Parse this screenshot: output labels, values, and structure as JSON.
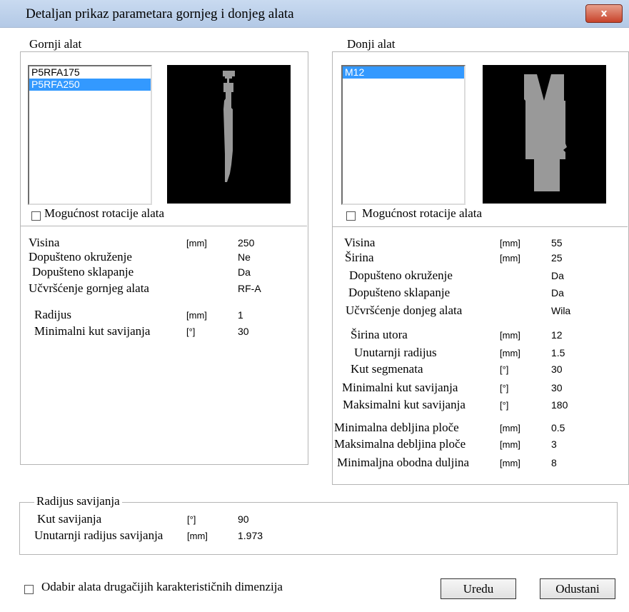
{
  "window": {
    "title": "Detaljan prikaz parametara gornjeg i donjeg alata",
    "close_label": "x"
  },
  "upper": {
    "title": "Gornji alat",
    "tools": [
      "P5RFA175",
      "P5RFA250"
    ],
    "selected_index": 1,
    "rotation_label": "Mogućnost rotacije alata",
    "params": [
      {
        "label": "Visina",
        "unit": "[mm]",
        "value": "250"
      },
      {
        "label": "Dopušteno okruženje",
        "unit": "",
        "value": "Ne"
      },
      {
        "label": "Dopušteno sklapanje",
        "unit": "",
        "value": "Da"
      },
      {
        "label": "Učvršćenje gornjeg alata",
        "unit": "",
        "value": "RF-A"
      },
      {
        "label": "Radijus",
        "unit": "[mm]",
        "value": "1"
      },
      {
        "label": "Minimalni kut savijanja",
        "unit": "[°]",
        "value": "30"
      }
    ]
  },
  "lower": {
    "title": "Donji alat",
    "tools": [
      "M12"
    ],
    "selected_index": 0,
    "rotation_label": "Mogućnost rotacije alata",
    "params": [
      {
        "label": "Visina",
        "unit": "[mm]",
        "value": "55"
      },
      {
        "label": "Širina",
        "unit": "[mm]",
        "value": "25"
      },
      {
        "label": "Dopušteno okruženje",
        "unit": "",
        "value": "Da"
      },
      {
        "label": "Dopušteno sklapanje",
        "unit": "",
        "value": "Da"
      },
      {
        "label": "Učvršćenje donjeg alata",
        "unit": "",
        "value": "Wila"
      },
      {
        "label": "Širina utora",
        "unit": "[mm]",
        "value": "12"
      },
      {
        "label": "Unutarnji radijus",
        "unit": "[mm]",
        "value": "1.5"
      },
      {
        "label": "Kut segmenata",
        "unit": "[°]",
        "value": "30"
      },
      {
        "label": "Minimalni kut savijanja",
        "unit": "[°]",
        "value": "30"
      },
      {
        "label": "Maksimalni kut savijanja",
        "unit": "[°]",
        "value": "180"
      },
      {
        "label": "Minimalna debljina ploče",
        "unit": "[mm]",
        "value": "0.5"
      },
      {
        "label": "Maksimalna debljina ploče",
        "unit": "[mm]",
        "value": "3"
      },
      {
        "label": "Minimaljna obodna duljina",
        "unit": "[mm]",
        "value": "8"
      }
    ]
  },
  "bend": {
    "title": "Radijus savijanja",
    "params": [
      {
        "label": "Kut savijanja",
        "unit": "[°]",
        "value": "90"
      },
      {
        "label": "Unutarnji radijus savijanja",
        "unit": "[mm]",
        "value": "1.973"
      }
    ]
  },
  "footer": {
    "checkbox_label": "Odabir alata drugačijih karakterističnih dimenzija",
    "ok_label": "Uredu",
    "cancel_label": "Odustani"
  },
  "colors": {
    "selection": "#3399ff",
    "tool_fill": "#999999",
    "preview_bg": "#000000"
  }
}
